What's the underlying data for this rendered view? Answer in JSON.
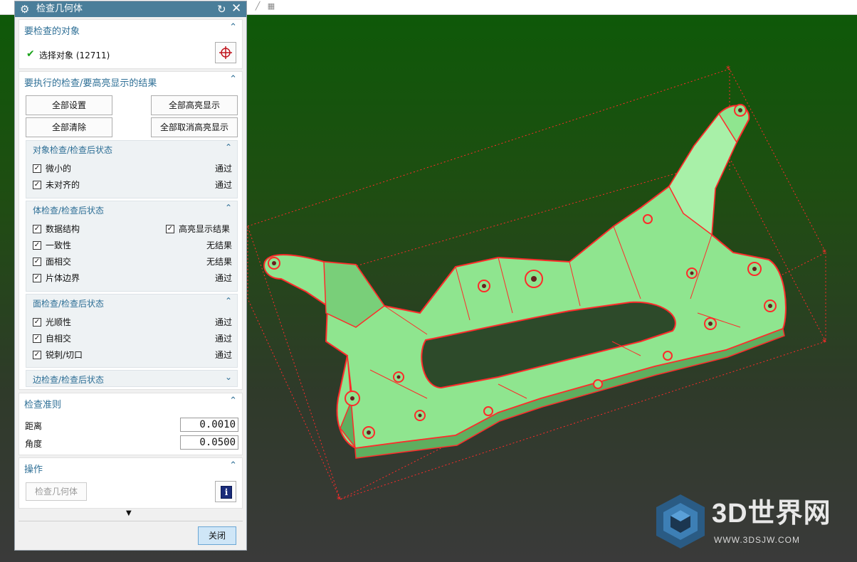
{
  "dialog": {
    "title": "检查几何体",
    "select_section": {
      "title": "要检查的对象",
      "selection_label": "选择对象 (12711)"
    },
    "checks_section": {
      "title": "要执行的检查/要高亮显示的结果",
      "buttons": {
        "set_all": "全部设置",
        "highlight_all": "全部高亮显示",
        "clear_all": "全部清除",
        "unhighlight_all": "全部取消高亮显示"
      },
      "object_checks": {
        "title": "对象检查/检查后状态",
        "items": [
          {
            "label": "微小的",
            "status": "通过"
          },
          {
            "label": "未对齐的",
            "status": "通过"
          }
        ]
      },
      "body_checks": {
        "title": "体检查/检查后状态",
        "highlight_label": "高亮显示结果",
        "items": [
          {
            "label": "数据结构",
            "status": ""
          },
          {
            "label": "一致性",
            "status": "无结果"
          },
          {
            "label": "面相交",
            "status": "无结果"
          },
          {
            "label": "片体边界",
            "status": "通过"
          }
        ]
      },
      "face_checks": {
        "title": "面检查/检查后状态",
        "items": [
          {
            "label": "光顺性",
            "status": "通过"
          },
          {
            "label": "自相交",
            "status": "通过"
          },
          {
            "label": "锐刺/切口",
            "status": "通过"
          }
        ]
      },
      "edge_checks": {
        "title": "边检查/检查后状态"
      }
    },
    "criteria_section": {
      "title": "检查准则",
      "distance_label": "距离",
      "distance_value": "0.0010",
      "angle_label": "角度",
      "angle_value": "0.0500"
    },
    "operation_section": {
      "title": "操作",
      "check_button": "检查几何体",
      "info_icon_glyph": "i"
    },
    "close_button": "关闭"
  },
  "watermark": {
    "brand": "3D世界网",
    "url": "WWW.3DSJW.COM"
  },
  "colors": {
    "title_bar": "#4a7e9a",
    "accent": "#2e6f96",
    "model_fill": "#8fe58f",
    "model_edge": "#ff2a2a"
  }
}
